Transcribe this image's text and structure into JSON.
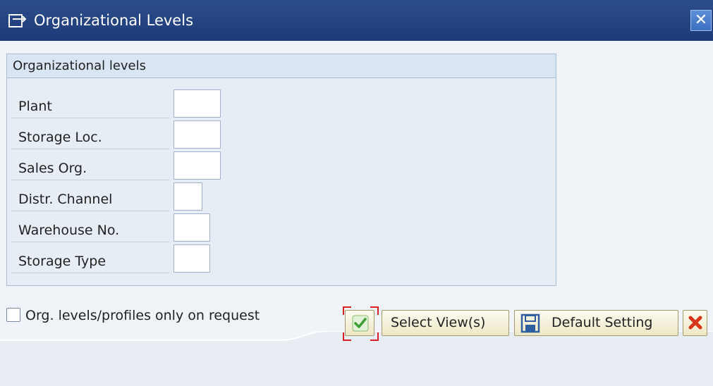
{
  "window": {
    "title": "Organizational Levels",
    "close_glyph": "✕"
  },
  "group": {
    "title": "Organizational levels",
    "fields": [
      {
        "label": "Plant",
        "value": ""
      },
      {
        "label": "Storage Loc.",
        "value": ""
      },
      {
        "label": "Sales Org.",
        "value": ""
      },
      {
        "label": "Distr. Channel",
        "value": ""
      },
      {
        "label": "Warehouse No.",
        "value": ""
      },
      {
        "label": "Storage Type",
        "value": ""
      }
    ]
  },
  "options": {
    "org_levels_on_request_label": "Org. levels/profiles only on request",
    "org_levels_on_request_checked": false
  },
  "toolbar": {
    "confirm_icon": "checkmark-icon",
    "select_views_label": "Select View(s)",
    "default_setting_label": "Default Setting",
    "default_setting_icon": "save-icon",
    "cancel_icon": "cancel-icon"
  },
  "colors": {
    "titlebar": "#1e3a78",
    "group_header": "#d9e5f3",
    "button": "#f3eed6",
    "confirm_green": "#3aa034",
    "cancel_red": "#d6361c"
  }
}
